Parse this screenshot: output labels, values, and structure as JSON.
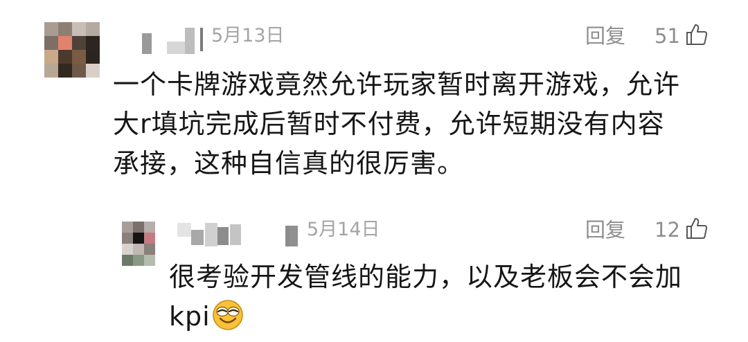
{
  "comments": [
    {
      "date": "5月13日",
      "reply_label": "回复",
      "likes": "51",
      "lines": [
        "一个卡牌游戏竟然允许玩家暂时离开游戏，允许",
        "大r填坑完成后暂时不付费，允许短期没有内容",
        "承接，这种自信真的很厉害。"
      ]
    },
    {
      "date": "5月14日",
      "reply_label": "回复",
      "likes": "12",
      "lines": [
        "很考验开发管线的能力，以及老板会不会加",
        "kpi"
      ],
      "emoji": "grinning-squinting-emoji"
    }
  ],
  "icons": {
    "like": "thumbs-up-icon",
    "avatar": "blurred-avatar"
  },
  "colors": {
    "meta_gray": "#a4a4a4",
    "action_gray": "#8e8e8e",
    "text": "#161616",
    "emoji_yellow": "#f7c23a"
  }
}
